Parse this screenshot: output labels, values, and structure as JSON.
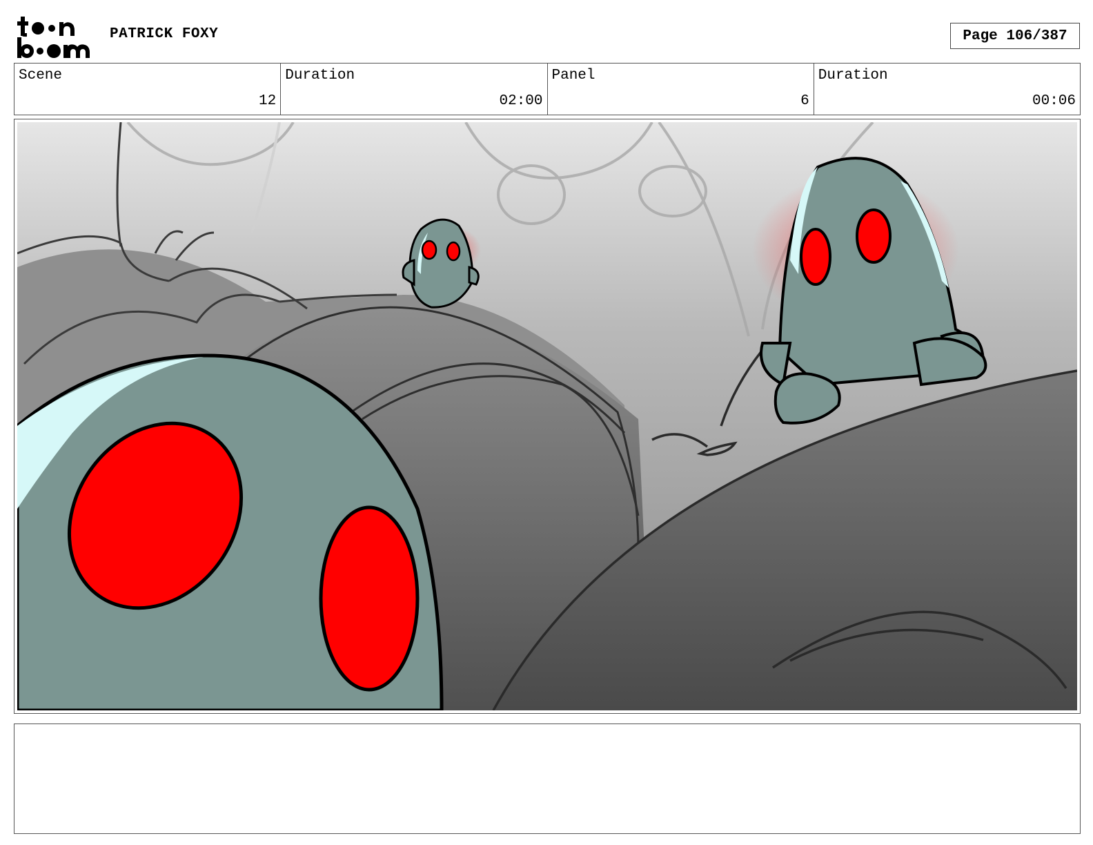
{
  "header": {
    "project_title": "PATRICK FOXY",
    "page_label": "Page 106/387"
  },
  "info": [
    {
      "label": "Scene",
      "value": "12"
    },
    {
      "label": "Duration",
      "value": "02:00"
    },
    {
      "label": "Panel",
      "value": "6"
    },
    {
      "label": "Duration",
      "value": "00:06"
    }
  ],
  "colors": {
    "creature_body": "#7b9692",
    "creature_highlight": "#d6f8f8",
    "eye_red": "#ff0000",
    "outline": "#000000"
  },
  "icons": {
    "logo": "toon-boom-logo"
  }
}
